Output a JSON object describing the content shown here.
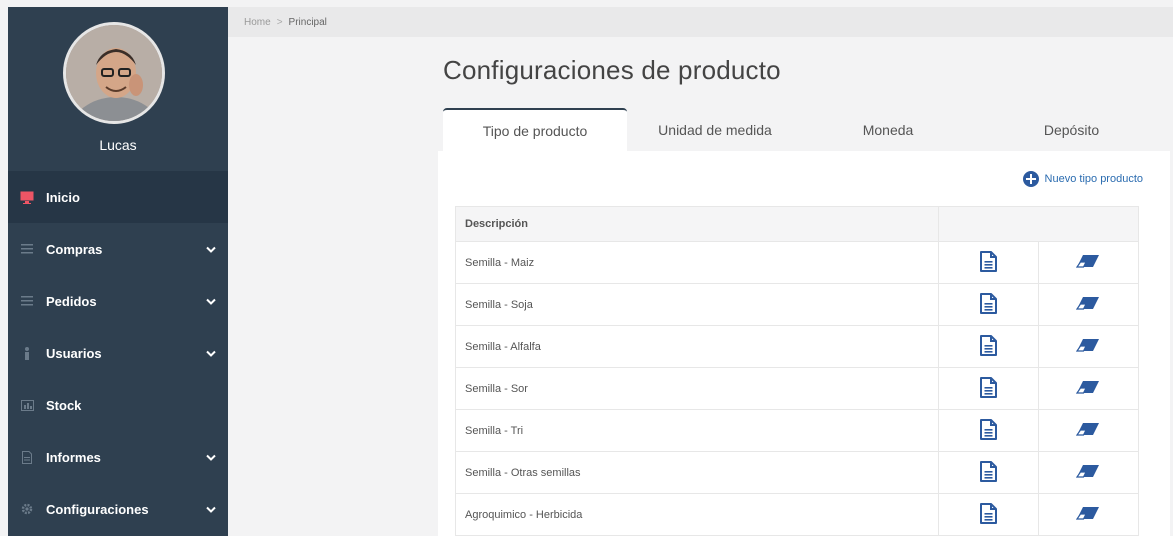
{
  "user": {
    "name": "Lucas"
  },
  "sidebar": {
    "items": [
      {
        "label": "Inicio",
        "icon": "monitor-icon",
        "active": true,
        "has_dropdown": false
      },
      {
        "label": "Compras",
        "icon": "menu-lines-icon",
        "active": false,
        "has_dropdown": true
      },
      {
        "label": "Pedidos",
        "icon": "menu-lines-icon",
        "active": false,
        "has_dropdown": true
      },
      {
        "label": "Usuarios",
        "icon": "person-icon",
        "active": false,
        "has_dropdown": true
      },
      {
        "label": "Stock",
        "icon": "chart-icon",
        "active": false,
        "has_dropdown": false
      },
      {
        "label": "Informes",
        "icon": "document-icon",
        "active": false,
        "has_dropdown": true
      },
      {
        "label": "Configuraciones",
        "icon": "gear-icon",
        "active": false,
        "has_dropdown": true
      }
    ]
  },
  "breadcrumb": {
    "home": "Home",
    "separator": ">",
    "current": "Principal"
  },
  "page": {
    "title": "Configuraciones de producto"
  },
  "tabs": [
    {
      "label": "Tipo de producto",
      "active": true
    },
    {
      "label": "Unidad de medida",
      "active": false
    },
    {
      "label": "Moneda",
      "active": false
    },
    {
      "label": "Depósito",
      "active": false
    }
  ],
  "actions": {
    "new_label": "Nuevo tipo producto"
  },
  "table": {
    "header": "Descripción",
    "rows": [
      "Semilla - Maiz",
      "Semilla - Soja",
      "Semilla - Alfalfa",
      "Semilla - Sor",
      "Semilla - Tri",
      "Semilla - Otras semillas",
      "Agroquimico - Herbicida"
    ]
  },
  "colors": {
    "sidebar_bg": "#2f4050",
    "sidebar_active": "#263646",
    "active_icon": "#ed5565",
    "link_blue": "#2b6cb0",
    "action_icon_blue": "#2c5a9f"
  }
}
